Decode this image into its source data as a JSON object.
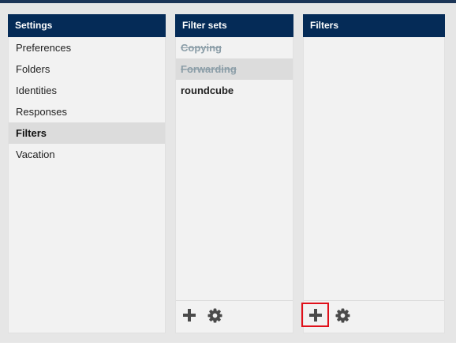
{
  "settings": {
    "header": "Settings",
    "items": [
      {
        "label": "Preferences"
      },
      {
        "label": "Folders"
      },
      {
        "label": "Identities"
      },
      {
        "label": "Responses"
      },
      {
        "label": "Filters",
        "selected": true
      },
      {
        "label": "Vacation"
      }
    ]
  },
  "filter_sets": {
    "header": "Filter sets",
    "items": [
      {
        "label": "Copying",
        "state": "disabled"
      },
      {
        "label": "Forwarding",
        "state": "disabled-selected"
      },
      {
        "label": "roundcube",
        "state": "active"
      }
    ],
    "footer": {
      "add_icon": "plus-icon",
      "actions_icon": "gear-icon"
    }
  },
  "filters": {
    "header": "Filters",
    "items": [],
    "footer": {
      "add_icon": "plus-icon",
      "actions_icon": "gear-icon",
      "highlighted": "add"
    }
  },
  "colors": {
    "header_bg": "#052b57",
    "highlight": "#e0101a",
    "disabled_text": "#8c9ea8"
  }
}
